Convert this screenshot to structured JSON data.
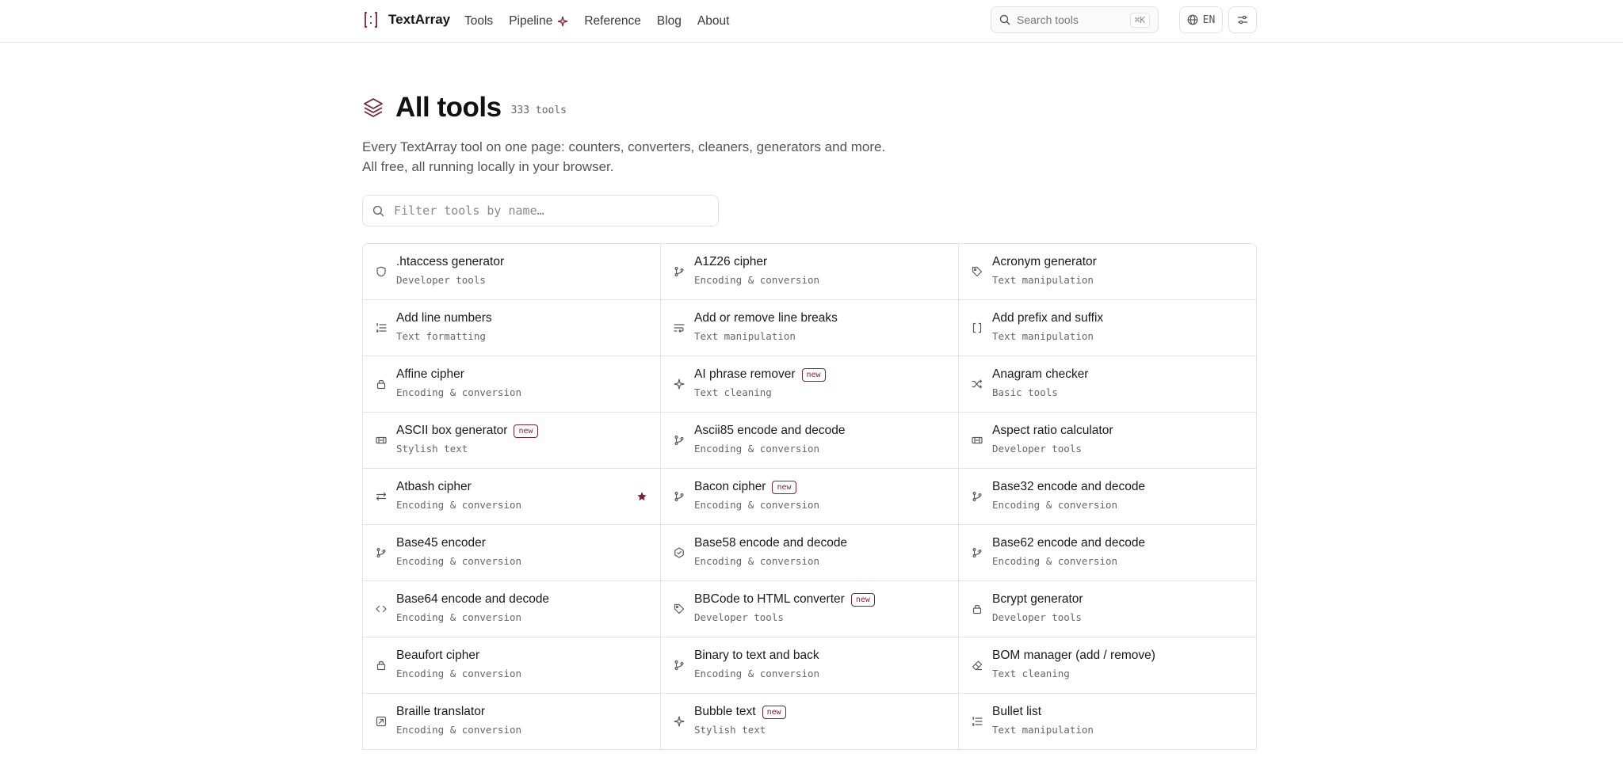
{
  "brand": {
    "name": "TextArray"
  },
  "nav": [
    {
      "label": "Tools"
    },
    {
      "label": "Pipeline"
    },
    {
      "label": "Reference"
    },
    {
      "label": "Blog"
    },
    {
      "label": "About"
    }
  ],
  "search": {
    "placeholder": "Search tools",
    "shortcut": "⌘K"
  },
  "language": {
    "label": "EN"
  },
  "page": {
    "title": "All tools",
    "count": "333 tools",
    "description": "Every TextArray tool on one page: counters, converters, cleaners, generators and more. All free, all running locally in your browser."
  },
  "filter": {
    "placeholder": "Filter tools by name…"
  },
  "colors": {
    "accent": "#7a2632",
    "border": "#e4e4e4",
    "muted": "#666666"
  },
  "tools": [
    {
      "name": ".htaccess generator",
      "category": "Developer tools",
      "icon": "shield-icon",
      "isNew": false,
      "starred": false
    },
    {
      "name": "A1Z26 cipher",
      "category": "Encoding & conversion",
      "icon": "git-branch-icon",
      "isNew": false,
      "starred": false
    },
    {
      "name": "Acronym generator",
      "category": "Text manipulation",
      "icon": "tag-icon",
      "isNew": false,
      "starred": false
    },
    {
      "name": "Add line numbers",
      "category": "Text formatting",
      "icon": "list-numbered-icon",
      "isNew": false,
      "starred": false
    },
    {
      "name": "Add or remove line breaks",
      "category": "Text manipulation",
      "icon": "wrap-text-icon",
      "isNew": false,
      "starred": false
    },
    {
      "name": "Add prefix and suffix",
      "category": "Text manipulation",
      "icon": "brackets-icon",
      "isNew": false,
      "starred": false
    },
    {
      "name": "Affine cipher",
      "category": "Encoding & conversion",
      "icon": "lock-icon",
      "isNew": false,
      "starred": false
    },
    {
      "name": "AI phrase remover",
      "category": "Text cleaning",
      "icon": "sparkle-icon",
      "isNew": true,
      "starred": false
    },
    {
      "name": "Anagram checker",
      "category": "Basic tools",
      "icon": "shuffle-icon",
      "isNew": false,
      "starred": false
    },
    {
      "name": "ASCII box generator",
      "category": "Stylish text",
      "icon": "ticket-icon",
      "isNew": true,
      "starred": false
    },
    {
      "name": "Ascii85 encode and decode",
      "category": "Encoding & conversion",
      "icon": "git-branch-icon",
      "isNew": false,
      "starred": false
    },
    {
      "name": "Aspect ratio calculator",
      "category": "Developer tools",
      "icon": "ticket-icon",
      "isNew": false,
      "starred": false
    },
    {
      "name": "Atbash cipher",
      "category": "Encoding & conversion",
      "icon": "swap-icon",
      "isNew": false,
      "starred": true
    },
    {
      "name": "Bacon cipher",
      "category": "Encoding & conversion",
      "icon": "git-branch-icon",
      "isNew": true,
      "starred": false
    },
    {
      "name": "Base32 encode and decode",
      "category": "Encoding & conversion",
      "icon": "git-branch-icon",
      "isNew": false,
      "starred": false
    },
    {
      "name": "Base45 encoder",
      "category": "Encoding & conversion",
      "icon": "git-branch-icon",
      "isNew": false,
      "starred": false
    },
    {
      "name": "Base58 encode and decode",
      "category": "Encoding & conversion",
      "icon": "hexagon-icon",
      "isNew": false,
      "starred": false
    },
    {
      "name": "Base62 encode and decode",
      "category": "Encoding & conversion",
      "icon": "git-branch-icon",
      "isNew": false,
      "starred": false
    },
    {
      "name": "Base64 encode and decode",
      "category": "Encoding & conversion",
      "icon": "code-icon",
      "isNew": false,
      "starred": false
    },
    {
      "name": "BBCode to HTML converter",
      "category": "Developer tools",
      "icon": "tag-icon",
      "isNew": true,
      "starred": false
    },
    {
      "name": "Bcrypt generator",
      "category": "Developer tools",
      "icon": "lock-icon",
      "isNew": false,
      "starred": false
    },
    {
      "name": "Beaufort cipher",
      "category": "Encoding & conversion",
      "icon": "lock-icon",
      "isNew": false,
      "starred": false
    },
    {
      "name": "Binary to text and back",
      "category": "Encoding & conversion",
      "icon": "git-branch-icon",
      "isNew": false,
      "starred": false
    },
    {
      "name": "BOM manager (add / remove)",
      "category": "Text cleaning",
      "icon": "eraser-icon",
      "isNew": false,
      "starred": false
    },
    {
      "name": "Braille translator",
      "category": "Encoding & conversion",
      "icon": "braille-icon",
      "isNew": false,
      "starred": false
    },
    {
      "name": "Bubble text",
      "category": "Stylish text",
      "icon": "sparkle-icon",
      "isNew": true,
      "starred": false
    },
    {
      "name": "Bullet list",
      "category": "Text manipulation",
      "icon": "list-numbered-icon",
      "isNew": false,
      "starred": false
    }
  ],
  "labels": {
    "new_badge": "new"
  }
}
